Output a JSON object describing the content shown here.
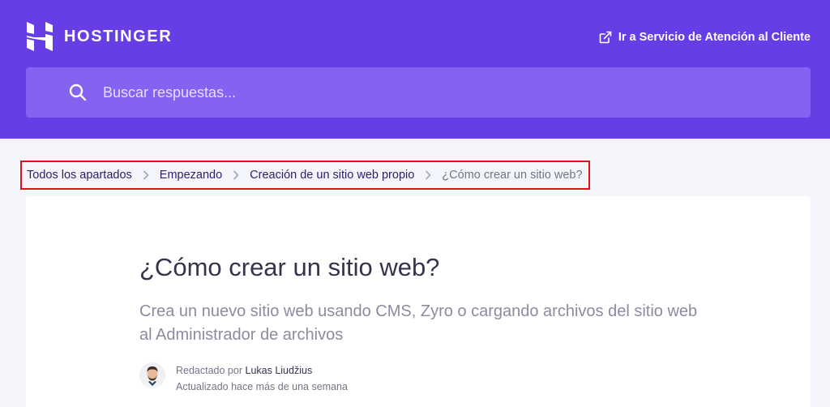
{
  "header": {
    "brand": "HOSTINGER",
    "support_link": "Ir a Servicio de Atención al Cliente",
    "background": "#673de6"
  },
  "search": {
    "placeholder": "Buscar respuestas..."
  },
  "breadcrumb": {
    "items": [
      "Todos los apartados",
      "Empezando",
      "Creación de un sitio web propio",
      "¿Cómo crear un sitio web?"
    ],
    "highlight_color": "#e3101a"
  },
  "article": {
    "title": "¿Cómo crear un sitio web?",
    "subtitle": "Crea un nuevo sitio web usando CMS, Zyro o cargando archivos del sitio web al Administrador de archivos",
    "author_prefix": "Redactado por",
    "author_name": "Lukas Liudžius",
    "updated": "Actualizado hace más de una semana"
  },
  "icons": {
    "logo": "hostinger-logo-icon",
    "support": "external-link-icon",
    "search": "search-icon",
    "separator": "chevron-right-icon"
  }
}
